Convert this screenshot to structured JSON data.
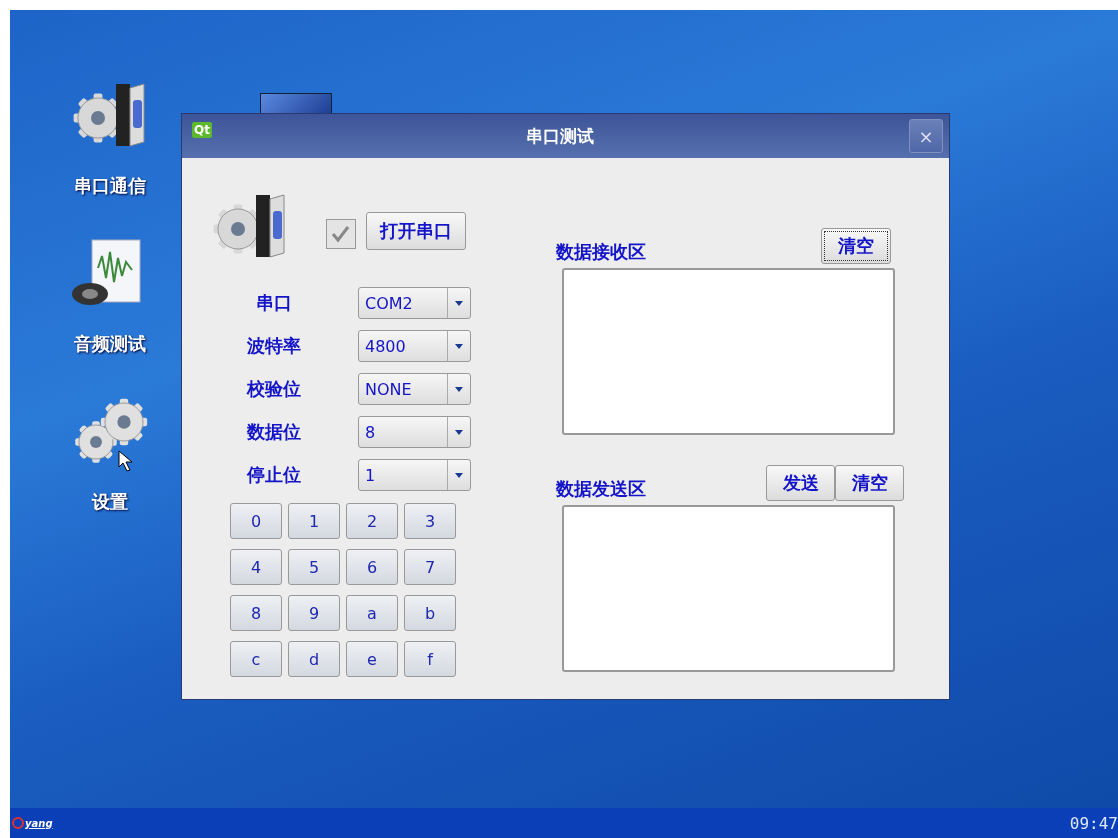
{
  "desktop": {
    "icons": [
      {
        "label": "串口通信",
        "kind": "serial"
      },
      {
        "label": "音频测试",
        "kind": "audio"
      },
      {
        "label": "设置",
        "kind": "settings"
      }
    ]
  },
  "dialog": {
    "app_icon": "Qt",
    "title": "串口测试",
    "close": "×",
    "open_port": {
      "checked": true,
      "label": "打开串口"
    },
    "settings": [
      {
        "label": "串口",
        "value": "COM2"
      },
      {
        "label": "波特率",
        "value": "4800"
      },
      {
        "label": "校验位",
        "value": "NONE"
      },
      {
        "label": "数据位",
        "value": "8"
      },
      {
        "label": "停止位",
        "value": "1"
      }
    ],
    "keypad": [
      "0",
      "1",
      "2",
      "3",
      "4",
      "5",
      "6",
      "7",
      "8",
      "9",
      "a",
      "b",
      "c",
      "d",
      "e",
      "f"
    ],
    "receive": {
      "label": "数据接收区",
      "buttons": [
        {
          "label": "清空",
          "focused": true
        }
      ]
    },
    "send": {
      "label": "数据发送区",
      "buttons": [
        {
          "label": "发送",
          "focused": false
        },
        {
          "label": "清空",
          "focused": false
        }
      ]
    }
  },
  "taskbar": {
    "logo": "yang",
    "clock": "09:47"
  }
}
